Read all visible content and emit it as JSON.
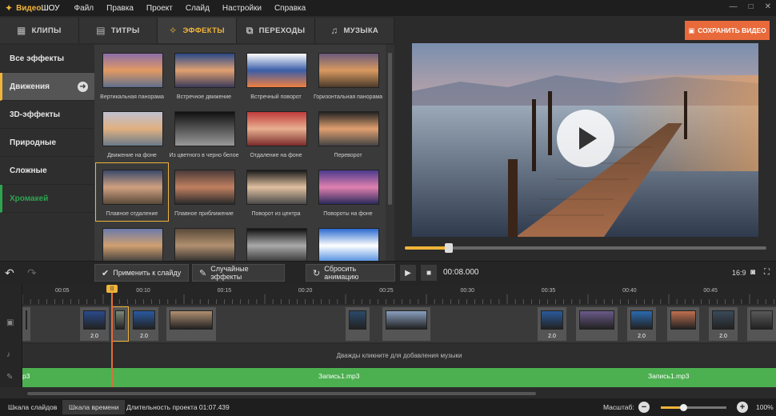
{
  "app": {
    "title_prefix": "Видео",
    "title_suffix": "ШОУ"
  },
  "menu": [
    "Файл",
    "Правка",
    "Проект",
    "Слайд",
    "Настройки",
    "Справка"
  ],
  "tabs": [
    {
      "label": "КЛИПЫ",
      "icon": "film-icon"
    },
    {
      "label": "ТИТРЫ",
      "icon": "text-icon"
    },
    {
      "label": "ЭФФЕКТЫ",
      "icon": "effects-icon",
      "active": true
    },
    {
      "label": "ПЕРЕХОДЫ",
      "icon": "transitions-icon"
    },
    {
      "label": "МУЗЫКА",
      "icon": "music-icon"
    }
  ],
  "categories": [
    "Все эффекты",
    "Движения",
    "3D-эффекты",
    "Природные",
    "Сложные",
    "Хромакей"
  ],
  "effects": [
    "Вертикальная панорама",
    "Встречное движение",
    "Встречный поворот",
    "Горизонтальная панорама",
    "Движение на фоне",
    "Из цветного в черно белое",
    "Отдаление на фоне",
    "Переворот",
    "Плавное отдаление",
    "Плавное приближение",
    "Поворот из центра",
    "Повороты на фоне",
    "",
    "",
    "",
    ""
  ],
  "save_button": "СОХРАНИТЬ ВИДЕО",
  "toolbar": {
    "apply": "Применить к слайду",
    "random": "Случайные эффекты",
    "reset": "Сбросить анимацию",
    "time": "00:08.000",
    "aspect": "16:9"
  },
  "ruler_ticks": [
    "00:05",
    "00:10",
    "00:15",
    "00:20",
    "00:25",
    "00:30",
    "00:35",
    "00:40",
    "00:45"
  ],
  "clip_duration": "2.0",
  "music_hint": "Дважды кликните для добавления музыки",
  "voice_clips": [
    "p3",
    "Запись1.mp3",
    "Запись1.mp3"
  ],
  "status": {
    "slides_tab": "Шкала слайдов",
    "timeline_tab": "Шкала времени",
    "duration": "Длительность проекта 01:07.439",
    "scale_label": "Масштаб:",
    "zoom": "100%"
  },
  "colors": {
    "accent": "#f0b43a",
    "save": "#e8693a",
    "voice_track": "#4caf50"
  }
}
